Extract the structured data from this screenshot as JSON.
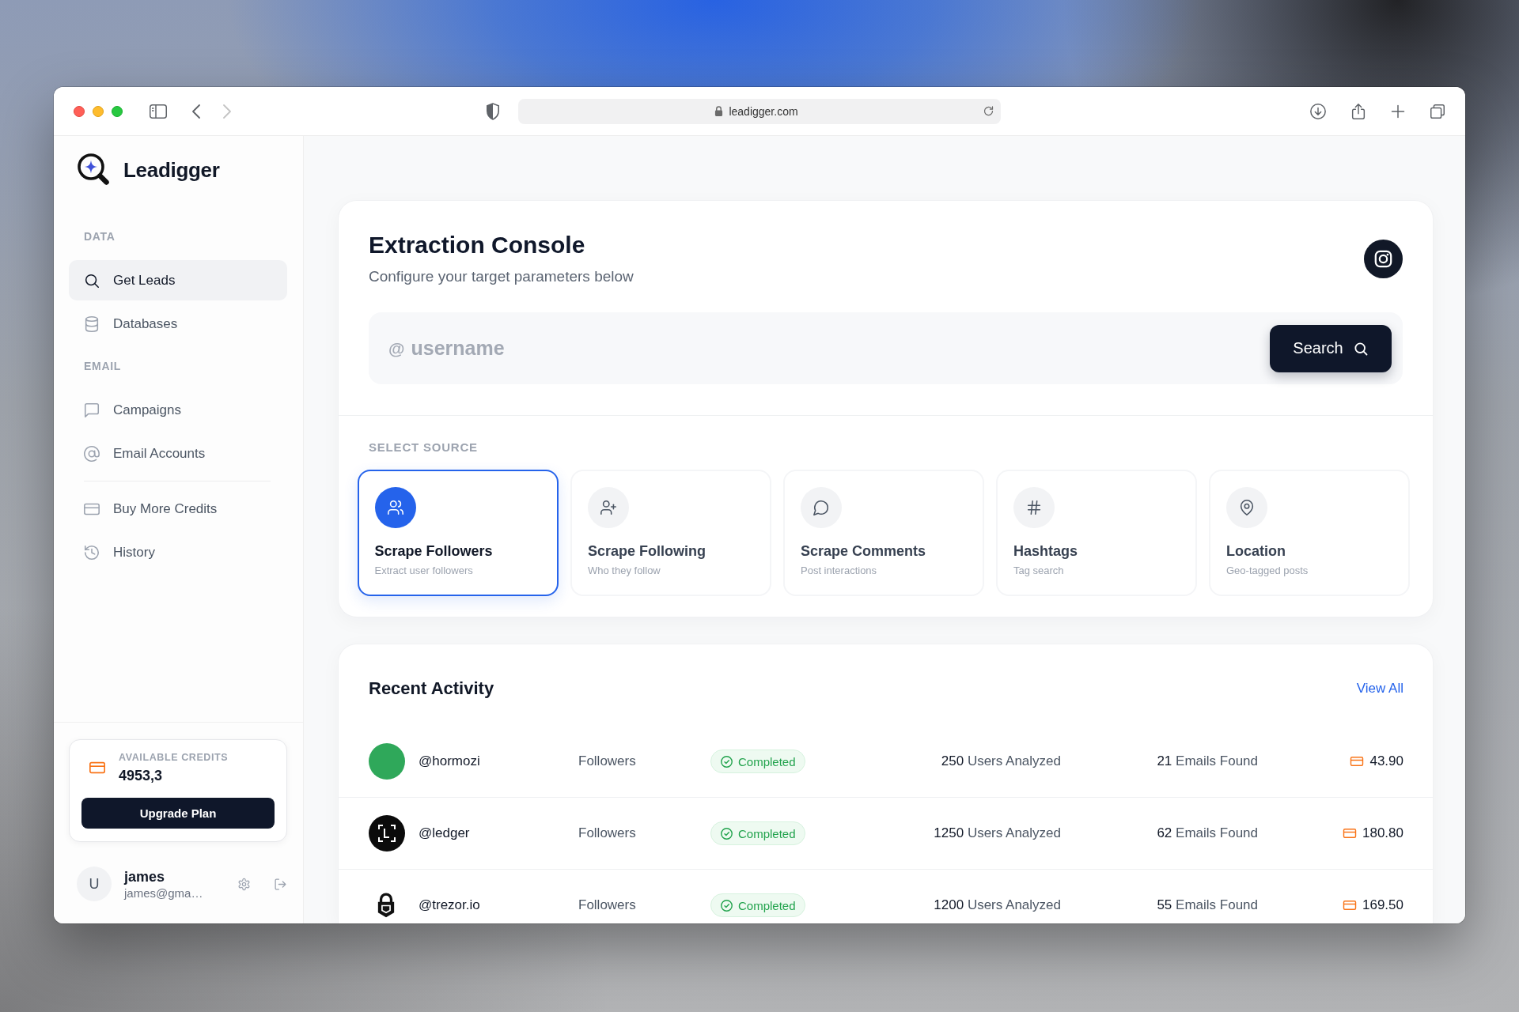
{
  "browser": {
    "url": "leadigger.com",
    "back_disabled": false,
    "forward_disabled": true
  },
  "sidebar": {
    "brand": "Leadigger",
    "groups": [
      {
        "label": "DATA",
        "items": [
          {
            "label": "Get Leads",
            "kind": "search",
            "selected": true
          },
          {
            "label": "Databases",
            "kind": "database",
            "selected": false
          }
        ]
      },
      {
        "label": "EMAIL",
        "items": [
          {
            "label": "Campaigns",
            "kind": "chat",
            "selected": false
          },
          {
            "label": "Email Accounts",
            "kind": "at",
            "selected": false
          }
        ]
      },
      {
        "items": [
          {
            "label": "Buy More Credits",
            "kind": "card",
            "selected": false
          },
          {
            "label": "History",
            "kind": "history",
            "selected": false
          }
        ]
      }
    ],
    "credits": {
      "label": "AVAILABLE CREDITS",
      "value": "4953,3",
      "button": "Upgrade Plan"
    },
    "user": {
      "initial": "U",
      "name": "james",
      "email": "james@gma…"
    }
  },
  "console": {
    "title": "Extraction Console",
    "subtitle": "Configure your target parameters below",
    "search": {
      "prefix": "@",
      "placeholder": "username",
      "button": "Search"
    },
    "source_label": "SELECT SOURCE",
    "sources": [
      {
        "kind": "followers",
        "title": "Scrape Followers",
        "subtitle": "Extract user followers",
        "selected": true
      },
      {
        "kind": "following",
        "title": "Scrape Following",
        "subtitle": "Who they follow",
        "selected": false
      },
      {
        "kind": "comments",
        "title": "Scrape Comments",
        "subtitle": "Post interactions",
        "selected": false
      },
      {
        "kind": "hashtags",
        "title": "Hashtags",
        "subtitle": "Tag search",
        "selected": false
      },
      {
        "kind": "location",
        "title": "Location",
        "subtitle": "Geo-tagged posts",
        "selected": false
      }
    ]
  },
  "activity": {
    "title": "Recent Activity",
    "link": "View All",
    "rows": [
      {
        "kind": "photo",
        "handle": "@hormozi",
        "type": "Followers",
        "status": "Completed",
        "users_count": "250",
        "users_label": "Users Analyzed",
        "emails_count": "21",
        "emails_label": "Emails Found",
        "credits": "43.90"
      },
      {
        "kind": "brackets",
        "handle": "@ledger",
        "type": "Followers",
        "status": "Completed",
        "users_count": "1250",
        "users_label": "Users Analyzed",
        "emails_count": "62",
        "emails_label": "Emails Found",
        "credits": "180.80"
      },
      {
        "kind": "padlock",
        "handle": "@trezor.io",
        "type": "Followers",
        "status": "Completed",
        "users_count": "1200",
        "users_label": "Users Analyzed",
        "emails_count": "55",
        "emails_label": "Emails Found",
        "credits": "169.50"
      }
    ]
  }
}
